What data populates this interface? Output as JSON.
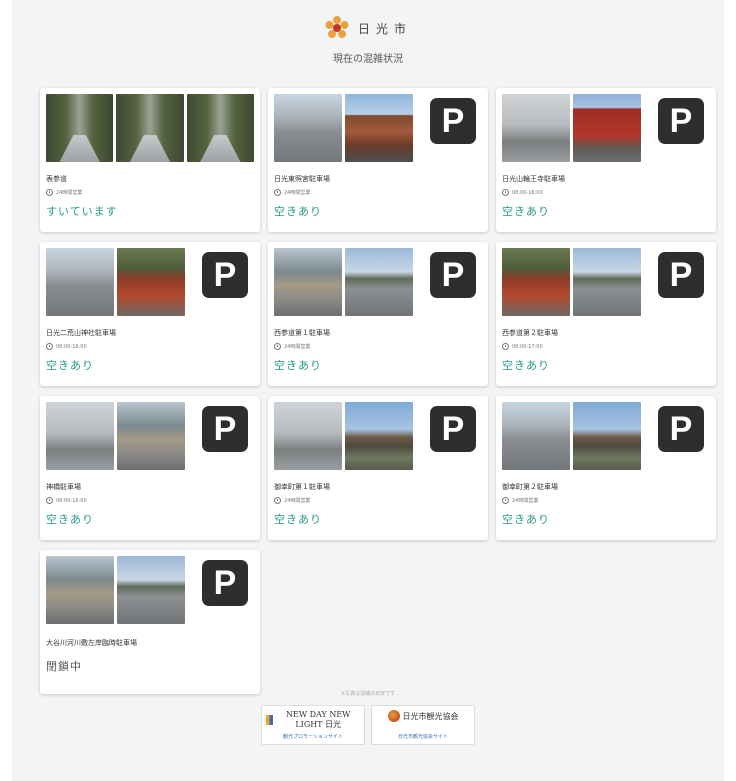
{
  "header": {
    "city_name": "日光市",
    "subtitle": "現在の混雑状況"
  },
  "cards": [
    {
      "name": "表参道",
      "hours": "24時間営業",
      "status": "すいています",
      "has_parking_icon": false
    },
    {
      "name": "日光東照宮駐車場",
      "hours": "24時間営業",
      "status": "空きあり",
      "has_parking_icon": true
    },
    {
      "name": "日光山輪王寺駐車場",
      "hours": "08:00-16:00",
      "status": "空きあり",
      "has_parking_icon": true
    },
    {
      "name": "日光二荒山神社駐車場",
      "hours": "08:00-16:00",
      "status": "空きあり",
      "has_parking_icon": true
    },
    {
      "name": "西参道第１駐車場",
      "hours": "24時間営業",
      "status": "空きあり",
      "has_parking_icon": true
    },
    {
      "name": "西参道第２駐車場",
      "hours": "08:00-17:00",
      "status": "空きあり",
      "has_parking_icon": true
    },
    {
      "name": "神橋駐車場",
      "hours": "08:00-16:00",
      "status": "空きあり",
      "has_parking_icon": true
    },
    {
      "name": "御幸町第１駐車場",
      "hours": "24時間営業",
      "status": "空きあり",
      "has_parking_icon": true
    },
    {
      "name": "御幸町第２駐車場",
      "hours": "24時間営業",
      "status": "空きあり",
      "has_parking_icon": true
    },
    {
      "name": "大谷川河川敷左岸臨時駐車場",
      "hours": "",
      "status": "閉鎖中",
      "has_parking_icon": true
    }
  ],
  "parking_label": "P",
  "footer": {
    "note": "※写真は混雑の目安です",
    "banner1_title": "NEW DAY NEW LIGHT 日光",
    "banner1_link": "観光プロモーションサイト",
    "banner2_title": "日光市観光協会",
    "banner2_link": "日光市観光協会サイト"
  },
  "colors": {
    "status_open": "#2a9a8b",
    "status_closed": "#555555",
    "parking_badge": "#2e2e2e"
  }
}
